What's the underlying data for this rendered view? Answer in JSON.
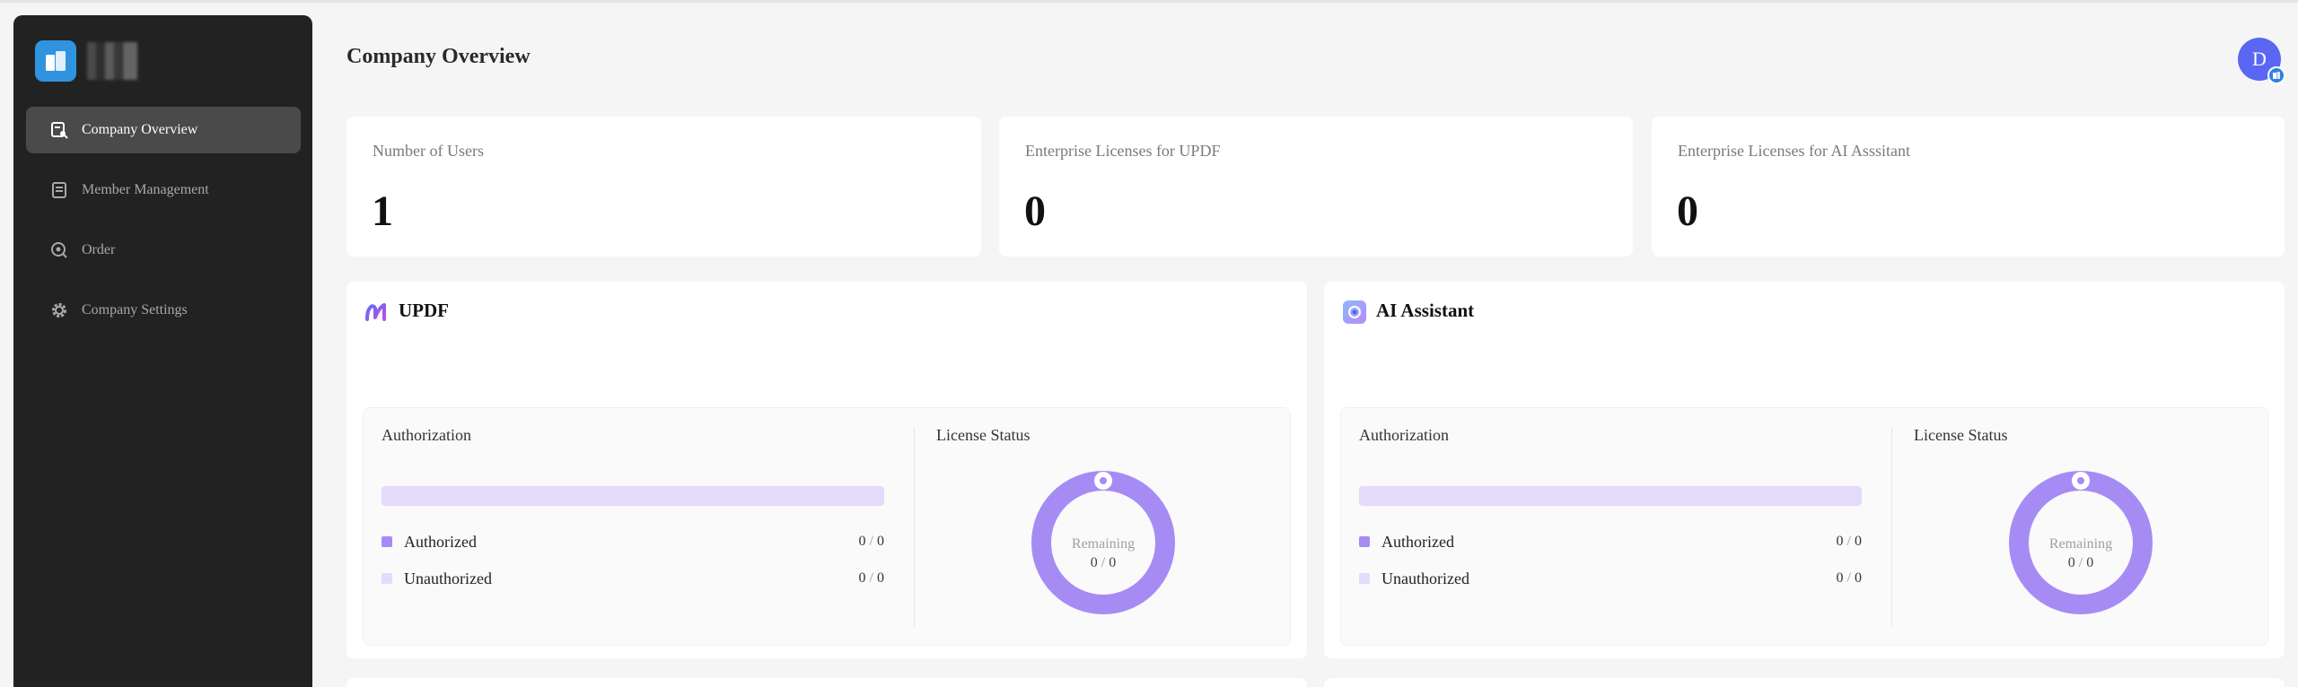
{
  "sidebar": {
    "items": [
      {
        "label": "Company Overview",
        "icon": "overview-icon",
        "active": true
      },
      {
        "label": "Member Management",
        "icon": "member-icon",
        "active": false
      },
      {
        "label": "Order",
        "icon": "order-icon",
        "active": false
      },
      {
        "label": "Company Settings",
        "icon": "gear-icon",
        "active": false
      }
    ]
  },
  "header": {
    "title": "Company Overview",
    "avatar_letter": "D"
  },
  "stats": [
    {
      "label": "Number of Users",
      "value": "1"
    },
    {
      "label": "Enterprise Licenses for UPDF",
      "value": "0"
    },
    {
      "label": "Enterprise Licenses for AI Asssitant",
      "value": "0"
    }
  ],
  "products": [
    {
      "name": "UPDF",
      "authorization_title": "Authorization",
      "license_status_title": "License Status",
      "authorized_label": "Authorized",
      "authorized_used": "0",
      "authorized_total": "0",
      "unauthorized_label": "Unauthorized",
      "unauthorized_used": "0",
      "unauthorized_total": "0",
      "remaining_label": "Remaining",
      "remaining_used": "0",
      "remaining_total": "0"
    },
    {
      "name": "AI Assistant",
      "authorization_title": "Authorization",
      "license_status_title": "License Status",
      "authorized_label": "Authorized",
      "authorized_used": "0",
      "authorized_total": "0",
      "unauthorized_label": "Unauthorized",
      "unauthorized_used": "0",
      "unauthorized_total": "0",
      "remaining_label": "Remaining",
      "remaining_used": "0",
      "remaining_total": "0"
    }
  ],
  "colors": {
    "sidebar_bg": "#222222",
    "accent_purple": "#a78bf5",
    "bar_light": "#e4dafb",
    "avatar": "#5a67f2"
  }
}
